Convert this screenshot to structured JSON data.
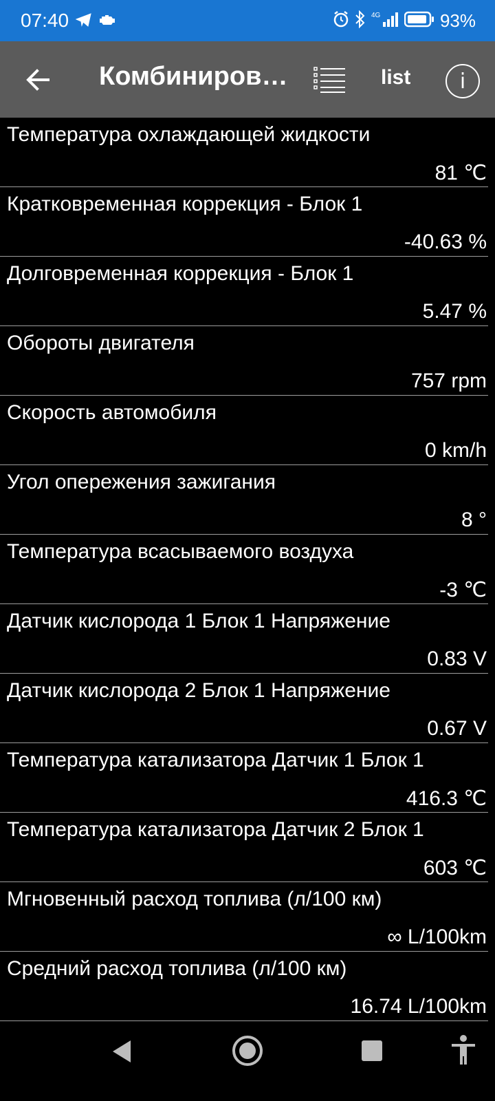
{
  "status_bar": {
    "time": "07:40",
    "battery_percent": "93%",
    "network_type": "4G",
    "battery_level": 0.93
  },
  "app_bar": {
    "title": "Комбиниров…",
    "list_button_label": "list",
    "info_button_label": "i"
  },
  "readings": [
    {
      "label": "Температура охлаждающей жидкости",
      "value": "81 ℃"
    },
    {
      "label": "Кратковременная коррекция - Блок 1",
      "value": "-40.63 %"
    },
    {
      "label": "Долговременная коррекция - Блок 1",
      "value": "5.47 %"
    },
    {
      "label": "Обороты двигателя",
      "value": "757 rpm"
    },
    {
      "label": "Скорость автомобиля",
      "value": "0 km/h"
    },
    {
      "label": "Угол опережения зажигания",
      "value": "8 °"
    },
    {
      "label": "Температура всасываемого воздуха",
      "value": "-3 ℃"
    },
    {
      "label": "Датчик кислорода 1 Блок 1 Напряжение",
      "value": "0.83 V"
    },
    {
      "label": "Датчик кислорода 2 Блок 1 Напряжение",
      "value": "0.67 V"
    },
    {
      "label": "Температура катализатора Датчик 1 Блок 1",
      "value": "416.3 ℃"
    },
    {
      "label": "Температура катализатора Датчик 2 Блок 1",
      "value": "603 ℃"
    },
    {
      "label": "Мгновенный расход топлива (л/100 км)",
      "value": "∞ L/100km"
    },
    {
      "label": "Средний расход топлива (л/100 км)",
      "value": "16.74 L/100km"
    }
  ],
  "colors": {
    "status_bar": "#1976d2",
    "app_bar": "#5b5b5b",
    "background": "#000000",
    "divider": "#9e9e9e"
  }
}
